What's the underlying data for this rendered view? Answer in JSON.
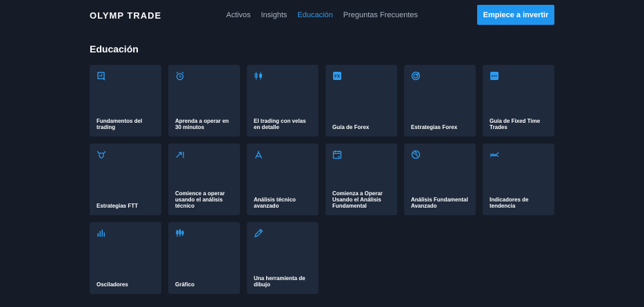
{
  "header": {
    "logo": "OLYMP TRADE",
    "nav": [
      {
        "label": "Activos",
        "active": false
      },
      {
        "label": "Insights",
        "active": false
      },
      {
        "label": "Educación",
        "active": true
      },
      {
        "label": "Preguntas Frecuentes",
        "active": false
      }
    ],
    "cta_label": "Empiece a invertir"
  },
  "page_title": "Educación",
  "colors": {
    "accent": "#1e96f0",
    "background": "#151b27",
    "card": "#1f2a3c"
  },
  "cards": [
    {
      "label": "Fundamentos del trading",
      "icon": "chart-box-icon"
    },
    {
      "label": "Aprenda a operar en 30 minutos",
      "icon": "alarm-clock-icon"
    },
    {
      "label": "El trading con velas en detalle",
      "icon": "candlestick-icon"
    },
    {
      "label": "Guía de Forex",
      "icon": "fx-badge-icon"
    },
    {
      "label": "Estrategias Forex",
      "icon": "target-icon"
    },
    {
      "label": "Guía de Fixed Time Trades",
      "icon": "ftt-badge-icon"
    },
    {
      "label": "Estrategias FTT",
      "icon": "bull-icon"
    },
    {
      "label": "Comience a operar usando el análisis técnico",
      "icon": "trend-arrow-icon"
    },
    {
      "label": "Análisis técnico avanzado",
      "icon": "compass-icon"
    },
    {
      "label": "Comienza a Operar Usando el Análisis Fundamental",
      "icon": "calendar-icon"
    },
    {
      "label": "Análisis Fundamental Avanzado",
      "icon": "globe-icon"
    },
    {
      "label": "Indicadores de tendencia",
      "icon": "trend-lines-icon"
    },
    {
      "label": "Osciladores",
      "icon": "bar-chart-icon"
    },
    {
      "label": "Gráfico",
      "icon": "candles-icon"
    },
    {
      "label": "Una herramienta de dibujo",
      "icon": "pencil-icon"
    }
  ]
}
